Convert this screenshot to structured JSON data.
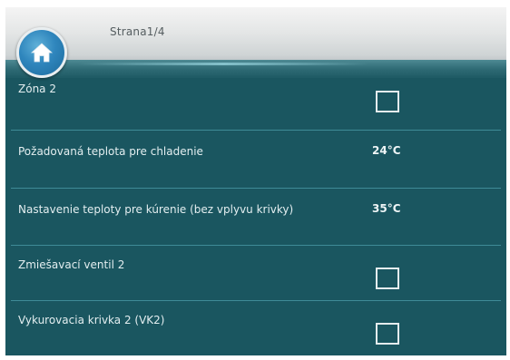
{
  "header": {
    "page_label": "Strana1/4",
    "home_icon": "home-icon"
  },
  "rows": [
    {
      "label": "Zóna 2",
      "control": "checkbox",
      "checked": false
    },
    {
      "label": "Požadovaná teplota pre chladenie",
      "control": "value",
      "value": "24°C"
    },
    {
      "label": "Nastavenie teploty pre kúrenie (bez vplyvu krivky)",
      "control": "value",
      "value": "35°C"
    },
    {
      "label": "Zmiešavací ventil 2",
      "control": "checkbox",
      "checked": false
    },
    {
      "label": "Vykurovacia krivka 2 (VK2)",
      "control": "checkbox",
      "checked": false
    }
  ],
  "colors": {
    "background": "#1a5660",
    "divider": "#3f8b97",
    "text": "#e3eef0",
    "home_button": "#2f86bd"
  }
}
